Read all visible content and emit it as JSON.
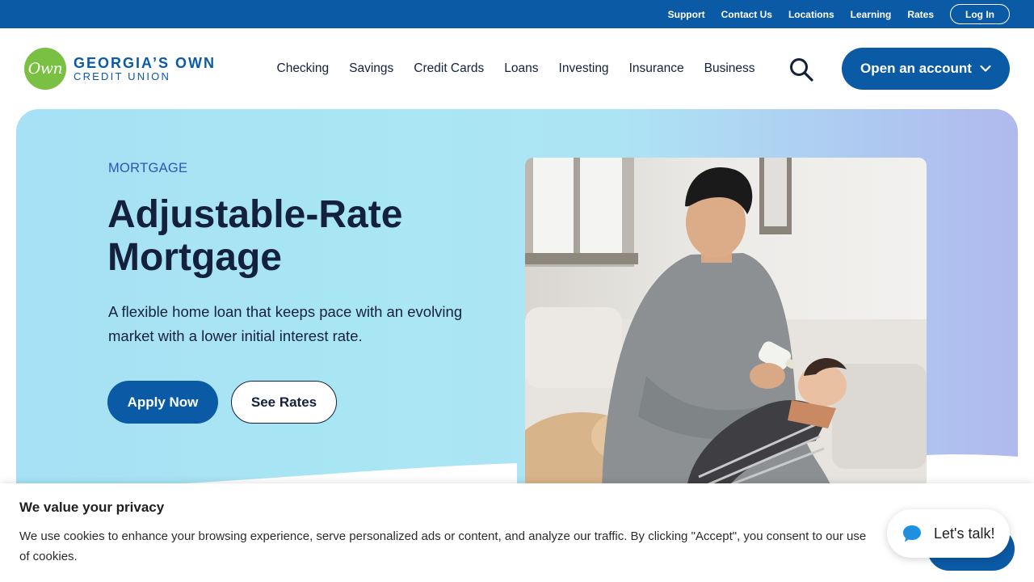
{
  "utility_nav": {
    "links": [
      "Support",
      "Contact Us",
      "Locations",
      "Learning",
      "Rates"
    ],
    "login_label": "Log In"
  },
  "header": {
    "logo": {
      "script": "Own",
      "line1": "GEORGIA’S OWN",
      "line2": "CREDIT UNION"
    },
    "nav": [
      "Checking",
      "Savings",
      "Credit Cards",
      "Loans",
      "Investing",
      "Insurance",
      "Business"
    ],
    "search_icon": "search-icon",
    "open_account_label": "Open an account"
  },
  "hero": {
    "eyebrow": "MORTGAGE",
    "title": "Adjustable-Rate Mortgage",
    "description": "A flexible home loan that keeps pace with an evolving market with a lower initial interest rate.",
    "apply_label": "Apply Now",
    "rates_label": "See Rates"
  },
  "cookie_banner": {
    "title": "We value your privacy",
    "text": "We use cookies to enhance your browsing experience, serve personalized ads or content, and analyze our traffic. By clicking \"Accept\", you consent to our use of cookies."
  },
  "chat": {
    "label": "Let's talk!",
    "icon": "chat-bubble-icon"
  },
  "colors": {
    "brand_blue": "#0b5aa6",
    "brand_green": "#7ac143",
    "navy_text": "#14213d",
    "eyebrow_blue": "#2a55c0"
  }
}
